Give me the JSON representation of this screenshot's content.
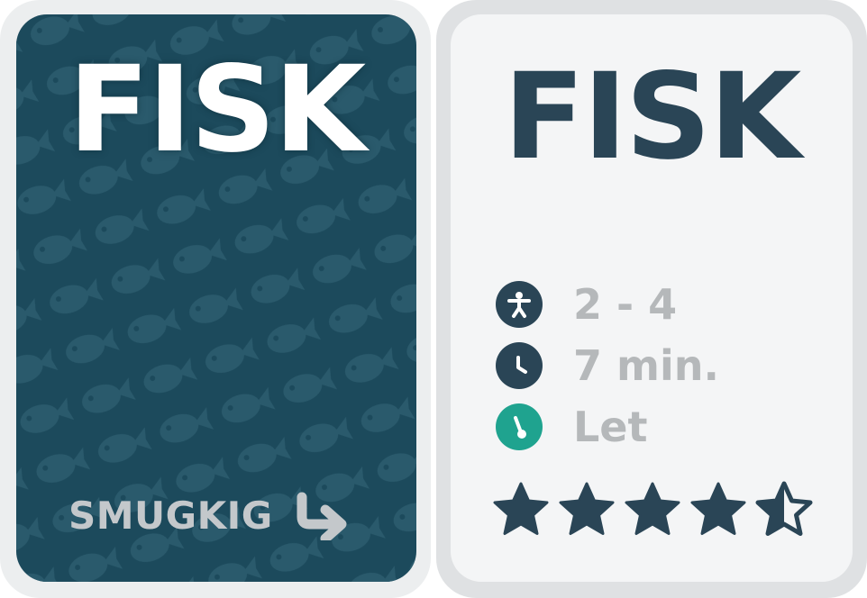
{
  "front": {
    "title": "FISK",
    "peek_label": "SMUGKIG",
    "peek_icon": "arrow-turn-icon",
    "pattern_icon": "fish-icon"
  },
  "back": {
    "title": "FISK",
    "info": [
      {
        "icon": "person-icon",
        "text": "2 - 4",
        "icon_color": "#2a4556"
      },
      {
        "icon": "clock-icon",
        "text": "7 min.",
        "icon_color": "#2a4556"
      },
      {
        "icon": "difficulty-gauge-icon",
        "text": "Let",
        "icon_color": "#1fa38f"
      }
    ],
    "rating": 4.5,
    "rating_max": 5
  },
  "colors": {
    "front_bg": "#1c4a5c",
    "text_dark": "#2a4556",
    "text_gray": "#b5b8ba",
    "accent_green": "#1fa38f"
  }
}
